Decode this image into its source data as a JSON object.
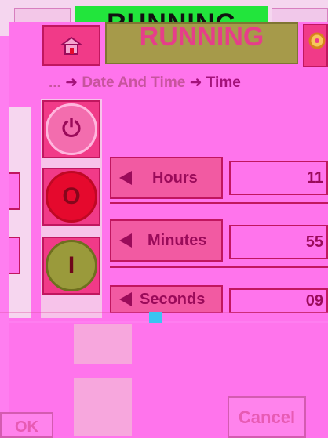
{
  "header": {
    "status_text": "RUNNING"
  },
  "breadcrumb": {
    "prefix": "...",
    "items": [
      "Date And Time",
      "Time"
    ]
  },
  "actions": [
    {
      "name": "power",
      "glyph": "⏻"
    },
    {
      "name": "stop",
      "glyph": "O"
    },
    {
      "name": "start",
      "glyph": "I"
    }
  ],
  "time_rows": [
    {
      "label": "Hours",
      "value": "11"
    },
    {
      "label": "Minutes",
      "value": "55"
    },
    {
      "label": "Seconds",
      "value": "09"
    }
  ],
  "dialog": {
    "cancel_label": "Cancel",
    "ok_label": "OK"
  },
  "colors": {
    "overlay": "#ff74ec",
    "accent_dark": "#9a0b5a",
    "running_bg": "#a69a4a",
    "stop": "#e5092d",
    "start": "#9a9a3b"
  }
}
